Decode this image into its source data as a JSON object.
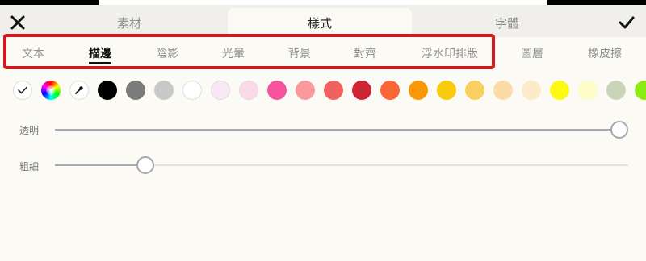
{
  "header": {
    "close_icon": "close-icon",
    "confirm_icon": "checkmark-icon",
    "tabs": [
      {
        "label": "素材",
        "active": false
      },
      {
        "label": "樣式",
        "active": true
      },
      {
        "label": "字體",
        "active": false
      }
    ]
  },
  "sub_tabs": [
    {
      "label": "文本",
      "active": false
    },
    {
      "label": "描邊",
      "active": true
    },
    {
      "label": "陰影",
      "active": false
    },
    {
      "label": "光暈",
      "active": false
    },
    {
      "label": "背景",
      "active": false
    },
    {
      "label": "對齊",
      "active": false
    },
    {
      "label": "浮水印排版",
      "active": false
    },
    {
      "label": "圖層",
      "active": false
    },
    {
      "label": "橡皮擦",
      "active": false
    }
  ],
  "highlight_color": "#d11a20",
  "colors": {
    "tools": [
      "checkmark-icon",
      "color-wheel-icon",
      "eyedropper-icon"
    ],
    "swatches": [
      "#000000",
      "#7b7b7b",
      "#c8c8c8",
      "#ffffff",
      "#f9e7f7",
      "#fcd8e6",
      "#f8549e",
      "#fa9a9c",
      "#f0625f",
      "#cf2338",
      "#fb6537",
      "#fb9808",
      "#facb0a",
      "#f9cf5f",
      "#fbdca8",
      "#fcebc9",
      "#fcfa14",
      "#fbfcc7",
      "#cad5b8",
      "#8cec12"
    ]
  },
  "sliders": {
    "opacity": {
      "label": "透明",
      "value": 1.0
    },
    "thickness": {
      "label": "粗細",
      "value": 0.16
    }
  }
}
